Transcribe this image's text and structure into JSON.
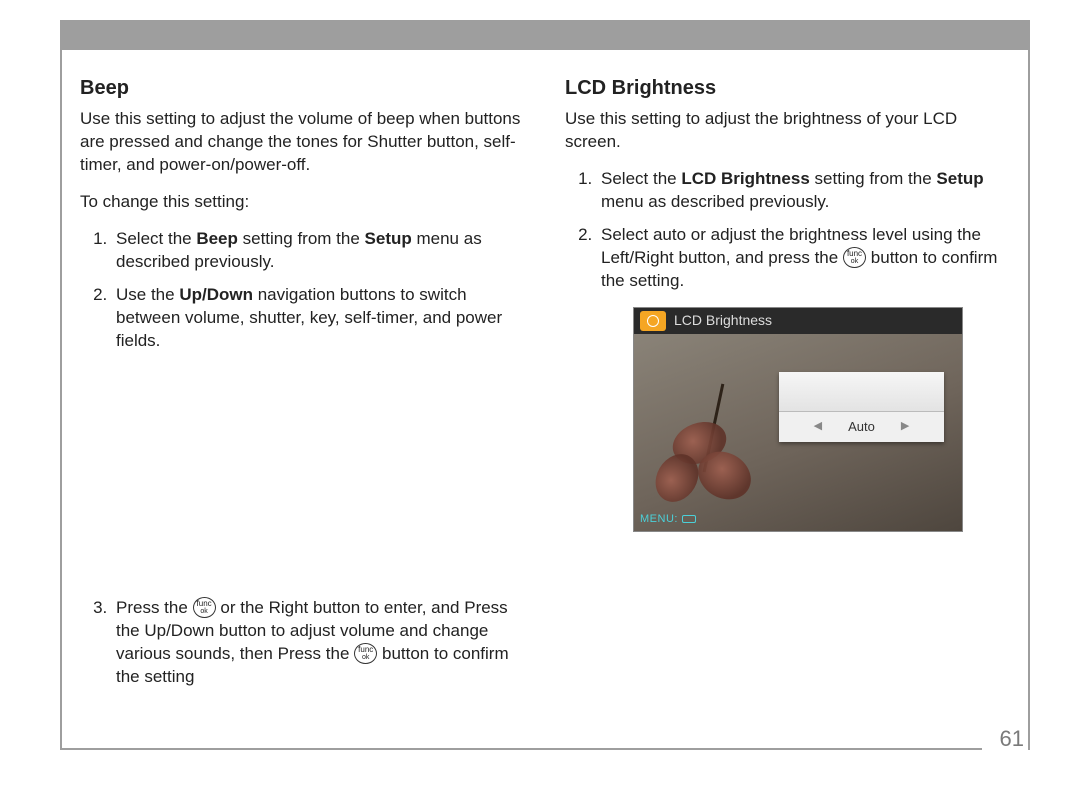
{
  "page_number": "61",
  "left": {
    "heading": "Beep",
    "intro": "Use this setting to adjust the volume of beep when buttons are pressed and change the tones for Shutter button, self-timer, and power-on/power-off.",
    "lead": "To change this setting:",
    "step1_pre": "Select the ",
    "step1_b1": "Beep",
    "step1_mid": " setting from the ",
    "step1_b2": "Setup",
    "step1_post": " menu as described previously.",
    "step2_pre": "Use the ",
    "step2_b1": "Up/Down",
    "step2_post": " navigation buttons to switch between volume, shutter, key, self-timer, and power fields.",
    "step3_a": "Press the ",
    "step3_b": " or the Right button to enter, and Press the Up/Down button to adjust volume and change various sounds, then Press the ",
    "step3_c": " button to confirm the setting"
  },
  "right": {
    "heading": "LCD Brightness",
    "intro": "Use this setting to adjust the brightness of your LCD screen.",
    "step1_pre": "Select the ",
    "step1_b1": "LCD Brightness",
    "step1_mid": " setting from the ",
    "step1_b2": "Setup",
    "step1_post": " menu as described previously.",
    "step2_a": "Select auto or adjust the brightness level using the Left/Right button, and press the ",
    "step2_b": " button to confirm the setting."
  },
  "screenshot": {
    "title": "LCD Brightness",
    "value": "Auto",
    "footer": "MENU:"
  },
  "func_label_top": "func",
  "func_label_bot": "ok"
}
